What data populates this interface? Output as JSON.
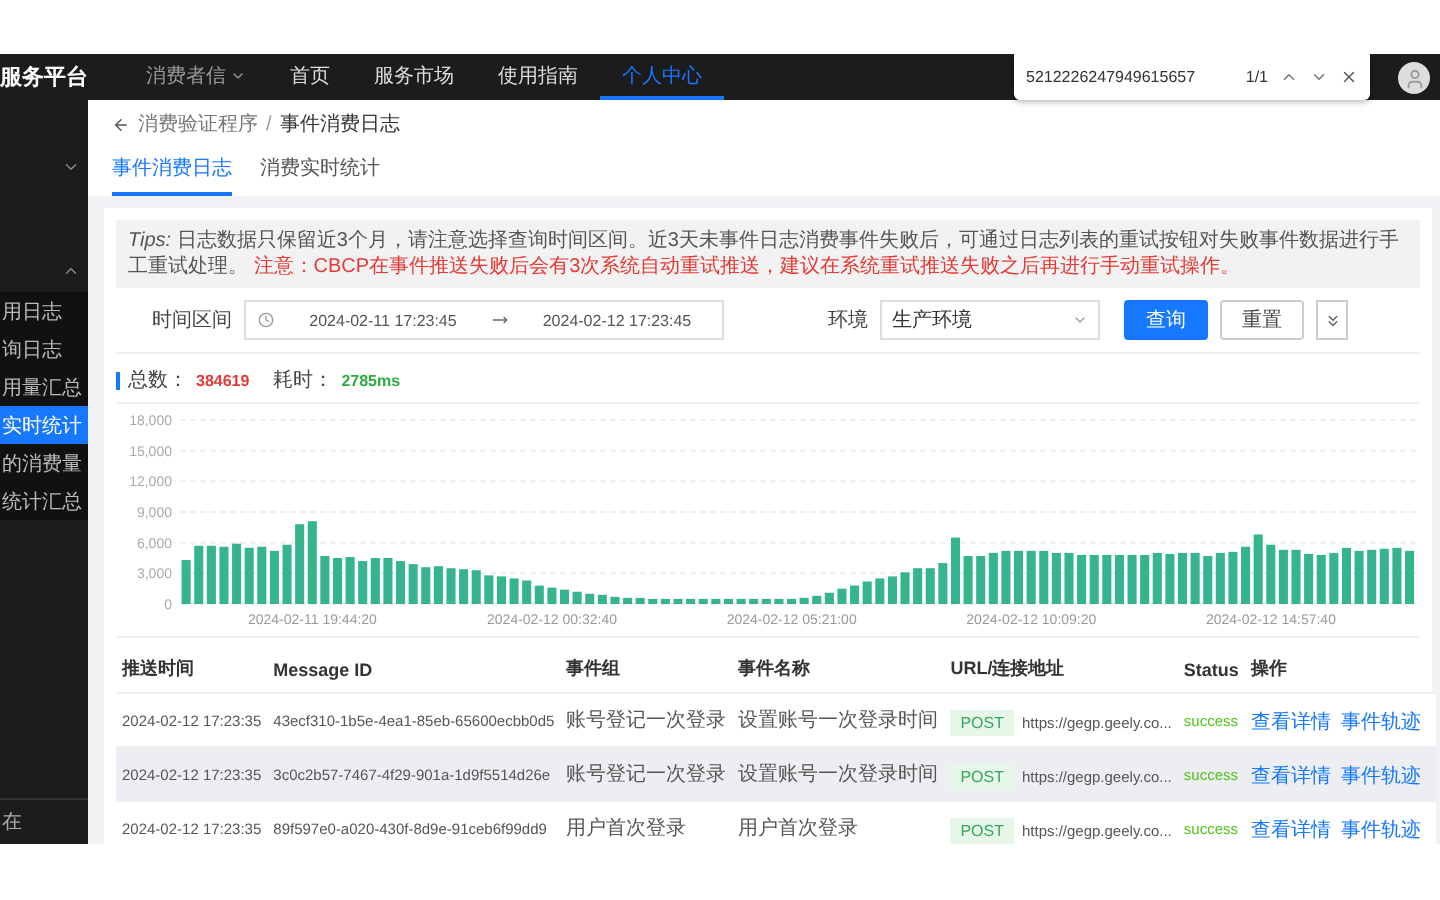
{
  "header": {
    "logo": "服务平台",
    "nav": [
      {
        "label": "消费者信",
        "kind": "dropdown",
        "selected": false
      },
      {
        "label": "首页",
        "kind": "link",
        "selected": false
      },
      {
        "label": "服务市场",
        "kind": "link",
        "selected": false
      },
      {
        "label": "使用指南",
        "kind": "link",
        "selected": false
      },
      {
        "label": "个人中心",
        "kind": "link",
        "selected": true
      }
    ]
  },
  "find_bar": {
    "query": "5212226247949615657",
    "count": "1/1"
  },
  "sidebar": {
    "groups": [
      {
        "expanded": false
      },
      {
        "expanded": true,
        "items": [
          {
            "label": "用日志",
            "selected": false
          },
          {
            "label": "询日志",
            "selected": false
          },
          {
            "label": "用量汇总",
            "selected": false
          },
          {
            "label": "实时统计",
            "selected": true
          },
          {
            "label": "的消费量",
            "selected": false
          },
          {
            "label": "统计汇总",
            "selected": false
          }
        ]
      }
    ],
    "footer": "在"
  },
  "breadcrumb": [
    "消费验证程序",
    "事件消费日志"
  ],
  "breadcrumb_separator": "/",
  "tabs": [
    {
      "label": "事件消费日志",
      "selected": true
    },
    {
      "label": "消费实时统计",
      "selected": false
    }
  ],
  "tips": {
    "prefix": "Tips:",
    "text": "日志数据只保留近3个月，请注意选择查询时间区间。近3天未事件日志消费事件失败后，可通过日志列表的重试按钮对失败事件数据进行手工重试处理。",
    "warning": "注意：CBCP在事件推送失败后会有3次系统自动重试推送，建议在系统重试推送失败之后再进行手动重试操作。"
  },
  "filters": {
    "time_label": "时间区间",
    "start": "2024-02-11 17:23:45",
    "end": "2024-02-12 17:23:45",
    "env_label": "环境",
    "env_value": "生产环境",
    "search_button": "查询",
    "reset_button": "重置"
  },
  "stats": {
    "total_label": "总数：",
    "total": "384619",
    "time_label": "耗时：",
    "time": "2785ms"
  },
  "chart_data": {
    "type": "bar",
    "grid": true,
    "ylim": [
      0,
      18000
    ],
    "yticks": [
      0,
      {
        "value": 3000,
        "label": "3,000"
      },
      {
        "value": 6000,
        "label": "6,000"
      },
      {
        "value": 9000,
        "label": "9,000"
      },
      {
        "value": 12000,
        "label": "12,000"
      },
      {
        "value": 15000,
        "label": "15,000"
      },
      {
        "value": 18000,
        "label": "18,000"
      }
    ],
    "values": [
      4300,
      5700,
      5700,
      5600,
      5900,
      5500,
      5600,
      5200,
      5800,
      7800,
      8100,
      4700,
      4500,
      4600,
      4200,
      4500,
      4500,
      4200,
      3900,
      3600,
      3700,
      3500,
      3400,
      3300,
      2800,
      2700,
      2500,
      2300,
      1800,
      1600,
      1400,
      1200,
      1000,
      900,
      700,
      600,
      600,
      500,
      500,
      500,
      500,
      500,
      500,
      500,
      500,
      500,
      500,
      500,
      500,
      600,
      800,
      1100,
      1500,
      1800,
      2200,
      2500,
      2700,
      3100,
      3500,
      3500,
      4000,
      6500,
      4700,
      4700,
      5000,
      5200,
      5200,
      5200,
      5200,
      5000,
      5000,
      4800,
      4800,
      4800,
      4800,
      4800,
      4800,
      5000,
      4900,
      5000,
      5000,
      4700,
      5000,
      5100,
      5600,
      6800,
      5800,
      5300,
      5300,
      4900,
      4800,
      5000,
      5500,
      5200,
      5300,
      5400,
      5500,
      5200
    ]
  },
  "chart_time_labels": [
    "2024-02-11 19:44:20",
    "2024-02-12 00:32:40",
    "2024-02-12 05:21:00",
    "2024-02-12 10:09:20",
    "2024-02-12 14:57:40"
  ],
  "table": {
    "columns": [
      "推送时间",
      "Message ID",
      "事件组",
      "事件名称",
      "URL/连接地址",
      "Status",
      "操作"
    ],
    "rows": [
      {
        "time": "2024-02-12 17:23:35",
        "id": "43ecf310-1b5e-4ea1-85eb-65600ecbb0d5",
        "group": "账号登记一次登录",
        "name": "设置账号一次登录时间",
        "method": "POST",
        "url": "https://gegp.geely.co...",
        "status": "success",
        "actions": [
          "查看详情",
          "事件轨迹"
        ],
        "hovered": false
      },
      {
        "time": "2024-02-12 17:23:35",
        "id": "3c0c2b57-7467-4f29-901a-1d9f5514d26e",
        "group": "账号登记一次登录",
        "name": "设置账号一次登录时间",
        "method": "POST",
        "url": "https://gegp.geely.co...",
        "status": "success",
        "actions": [
          "查看详情",
          "事件轨迹"
        ],
        "hovered": true
      },
      {
        "time": "2024-02-12 17:23:35",
        "id": "89f597e0-a020-430f-8d9e-91ceb6f99dd9",
        "group": "用户首次登录",
        "name": "用户首次登录",
        "method": "POST",
        "url": "https://gegp.geely.co...",
        "status": "success",
        "actions": [
          "查看详情",
          "事件轨迹"
        ],
        "hovered": false
      }
    ]
  }
}
